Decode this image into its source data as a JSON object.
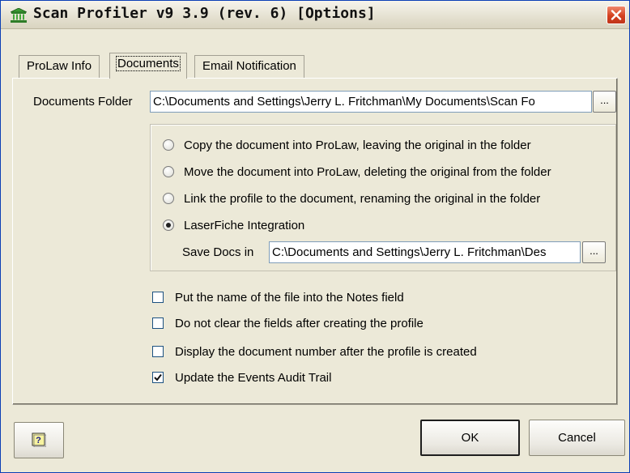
{
  "window": {
    "title": "Scan Profiler v9 3.9 (rev. 6) [Options]",
    "app_icon": "bank-building-icon",
    "close_icon": "close-icon"
  },
  "tabs": [
    {
      "label": "ProLaw Info",
      "active": false
    },
    {
      "label": "Documents",
      "active": true
    },
    {
      "label": "Email Notification",
      "active": false
    }
  ],
  "documents": {
    "folder_label": "Documents Folder",
    "folder_value": "C:\\Documents and Settings\\Jerry L. Fritchman\\My Documents\\Scan Fo",
    "browse_label": "...",
    "radio_options": [
      {
        "label": "Copy the document into ProLaw, leaving the original in the folder",
        "selected": false
      },
      {
        "label": "Move the document into ProLaw, deleting the original from the folder",
        "selected": false
      },
      {
        "label": "Link the profile to the document, renaming the original in the folder",
        "selected": false
      },
      {
        "label": "LaserFiche Integration",
        "selected": true
      }
    ],
    "save_docs_label": "Save Docs in",
    "save_docs_value": "C:\\Documents and Settings\\Jerry L. Fritchman\\Des",
    "save_browse_label": "...",
    "checkboxes": [
      {
        "label": "Put the name of the file into the Notes field",
        "checked": false
      },
      {
        "label": "Do not clear the fields after creating the profile",
        "checked": false
      },
      {
        "label": "Display the document number after the profile is created",
        "checked": false
      },
      {
        "label": "Update the Events Audit Trail",
        "checked": true
      }
    ]
  },
  "buttons": {
    "help_icon": "help-icon",
    "ok_label": "OK",
    "cancel_label": "Cancel"
  },
  "colors": {
    "window_bg": "#ece9d8",
    "close_button": "#d4401f",
    "field_border": "#7f9db9"
  }
}
